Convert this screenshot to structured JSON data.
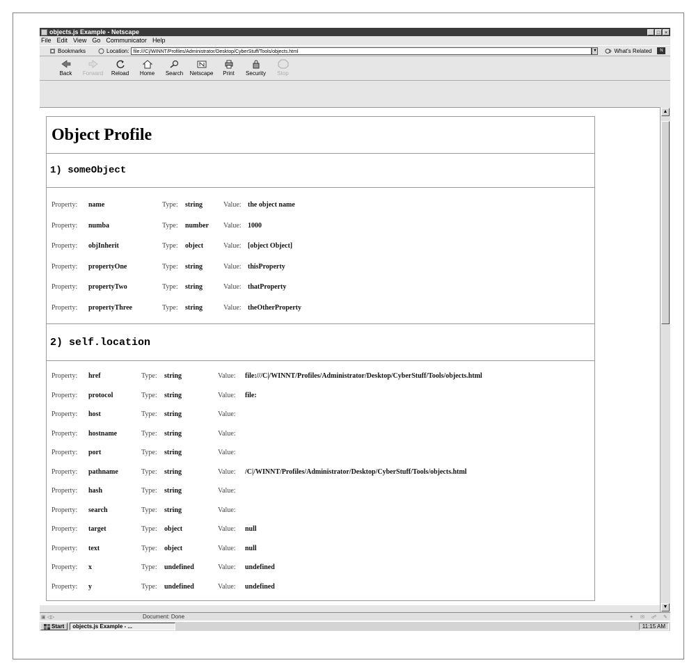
{
  "window": {
    "title": "objects.js Example - Netscape",
    "controls": [
      "_",
      "□",
      "×"
    ]
  },
  "menubar": [
    "File",
    "Edit",
    "View",
    "Go",
    "Communicator",
    "Help"
  ],
  "locationbar": {
    "bookmarks_label": "Bookmarks",
    "location_label": "Location:",
    "url": "file:///C|/WINNT/Profiles/Administrator/Desktop/CyberStuff/Tools/objects.html",
    "related_label": "What's Related"
  },
  "toolbar": [
    {
      "label": "Back",
      "icon": "back-icon",
      "enabled": true
    },
    {
      "label": "Forward",
      "icon": "forward-icon",
      "enabled": false
    },
    {
      "label": "Reload",
      "icon": "reload-icon",
      "enabled": true
    },
    {
      "label": "Home",
      "icon": "home-icon",
      "enabled": true
    },
    {
      "label": "Search",
      "icon": "search-icon",
      "enabled": true
    },
    {
      "label": "Netscape",
      "icon": "netscape-icon",
      "enabled": true
    },
    {
      "label": "Print",
      "icon": "print-icon",
      "enabled": true
    },
    {
      "label": "Security",
      "icon": "security-icon",
      "enabled": true
    },
    {
      "label": "Stop",
      "icon": "stop-icon",
      "enabled": false
    }
  ],
  "page": {
    "title": "Object Profile",
    "labels": {
      "property": "Property:",
      "type": "Type:",
      "value": "Value:"
    },
    "sections": [
      {
        "heading": "1) someObject",
        "rows": [
          {
            "name": "name",
            "type": "string",
            "value": "the object name"
          },
          {
            "name": "numba",
            "type": "number",
            "value": "1000"
          },
          {
            "name": "objInherit",
            "type": "object",
            "value": "[object Object]"
          },
          {
            "name": "propertyOne",
            "type": "string",
            "value": "thisProperty"
          },
          {
            "name": "propertyTwo",
            "type": "string",
            "value": "thatProperty"
          },
          {
            "name": "propertyThree",
            "type": "string",
            "value": "theOtherProperty"
          }
        ]
      },
      {
        "heading": "2) self.location",
        "rows": [
          {
            "name": "href",
            "type": "string",
            "value": "file:///C|/WINNT/Profiles/Administrator/Desktop/CyberStuff/Tools/objects.html"
          },
          {
            "name": "protocol",
            "type": "string",
            "value": "file:"
          },
          {
            "name": "host",
            "type": "string",
            "value": ""
          },
          {
            "name": "hostname",
            "type": "string",
            "value": ""
          },
          {
            "name": "port",
            "type": "string",
            "value": ""
          },
          {
            "name": "pathname",
            "type": "string",
            "value": "/C|/WINNT/Profiles/Administrator/Desktop/CyberStuff/Tools/objects.html"
          },
          {
            "name": "hash",
            "type": "string",
            "value": ""
          },
          {
            "name": "search",
            "type": "string",
            "value": ""
          },
          {
            "name": "target",
            "type": "object",
            "value": "null"
          },
          {
            "name": "text",
            "type": "object",
            "value": "null"
          },
          {
            "name": "x",
            "type": "undefined",
            "value": "undefined"
          },
          {
            "name": "y",
            "type": "undefined",
            "value": "undefined"
          }
        ]
      }
    ]
  },
  "status": {
    "text": "Document: Done"
  },
  "taskbar": {
    "start_label": "Start",
    "task_label": "objects.js Example - ...",
    "clock": "11:15 AM"
  }
}
